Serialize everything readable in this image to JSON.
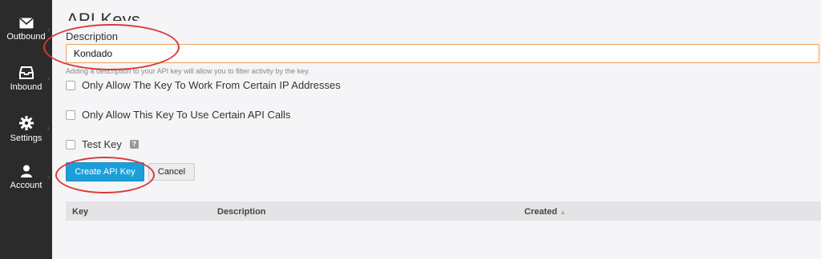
{
  "sidebar": {
    "items": [
      {
        "label": "Outbound",
        "icon": "envelope-icon"
      },
      {
        "label": "Inbound",
        "icon": "inbox-icon"
      },
      {
        "label": "Settings",
        "icon": "gear-icon"
      },
      {
        "label": "Account",
        "icon": "user-icon"
      }
    ]
  },
  "page": {
    "title": "API Keys"
  },
  "form": {
    "description_label": "Description",
    "description_value": "Kondado",
    "help_text": "Adding a description to your API key will allow you to filter activity by the key.",
    "ip_restrict_label": "Only Allow The Key To Work From Certain IP Addresses",
    "api_calls_restrict_label": "Only Allow This Key To Use Certain API Calls",
    "test_key_label": "Test Key",
    "test_key_help": "?",
    "create_button": "Create API Key",
    "cancel_button": "Cancel"
  },
  "table": {
    "columns": [
      "Key",
      "Description",
      "Created"
    ]
  },
  "colors": {
    "sidebar_bg": "#2b2b2b",
    "primary_button": "#1c9fd9",
    "annotation": "#d9383a",
    "input_focus_border": "#f0a05a"
  }
}
